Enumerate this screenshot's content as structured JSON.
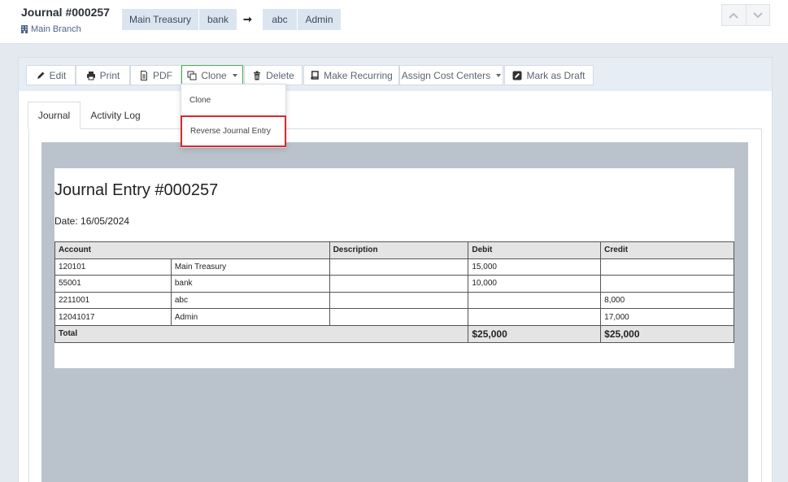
{
  "header": {
    "title": "Journal #000257",
    "branch": "Main Branch",
    "from_accounts": [
      "Main Treasury",
      "bank"
    ],
    "arrow": "➞",
    "to_accounts": [
      "abc",
      "Admin"
    ]
  },
  "toolbar": {
    "edit": "Edit",
    "print": "Print",
    "pdf": "PDF",
    "clone": "Clone",
    "delete": "Delete",
    "make_recurring": "Make Recurring",
    "assign_cost_centers": "Assign Cost Centers",
    "mark_as_draft": "Mark as Draft"
  },
  "clone_menu": {
    "items": [
      "Clone",
      "Reverse Journal Entry"
    ]
  },
  "tabs": [
    "Journal",
    "Activity Log"
  ],
  "document": {
    "title": "Journal Entry #000257",
    "date": "Date: 16/05/2024",
    "headers": [
      "Account",
      "Description",
      "Debit",
      "Credit"
    ],
    "rows": [
      {
        "code": "120101",
        "name": "Main Treasury",
        "description": "",
        "debit": "15,000",
        "credit": ""
      },
      {
        "code": "55001",
        "name": "bank",
        "description": "",
        "debit": "10,000",
        "credit": ""
      },
      {
        "code": "2211001",
        "name": "abc",
        "description": "",
        "debit": "",
        "credit": "8,000"
      },
      {
        "code": "12041017",
        "name": "Admin",
        "description": "",
        "debit": "",
        "credit": "17,000"
      }
    ],
    "total_label": "Total",
    "total_debit": "$25,000",
    "total_credit": "$25,000"
  },
  "colors": {
    "clone_active_border": "#4caf50",
    "highlight_border": "#d9292e",
    "pill_bg": "#dbe5f0",
    "toolbar_bg": "#e6edf4",
    "preview_bg": "#bac3cc"
  }
}
